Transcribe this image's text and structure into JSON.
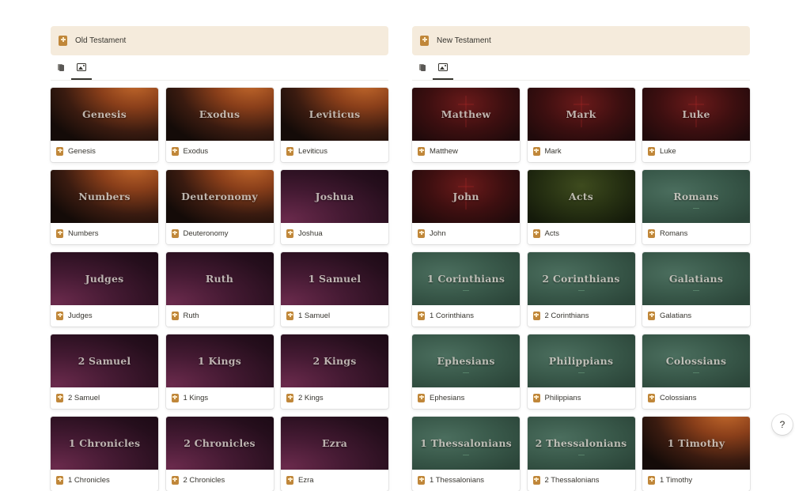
{
  "columns": [
    {
      "title": "Old Testament",
      "books": [
        {
          "name": "Genesis",
          "theme": "brown"
        },
        {
          "name": "Exodus",
          "theme": "brown"
        },
        {
          "name": "Leviticus",
          "theme": "brown"
        },
        {
          "name": "Numbers",
          "theme": "brown"
        },
        {
          "name": "Deuteronomy",
          "theme": "brown"
        },
        {
          "name": "Joshua",
          "theme": "plum"
        },
        {
          "name": "Judges",
          "theme": "plum"
        },
        {
          "name": "Ruth",
          "theme": "plum"
        },
        {
          "name": "1 Samuel",
          "theme": "plum"
        },
        {
          "name": "2 Samuel",
          "theme": "plum"
        },
        {
          "name": "1 Kings",
          "theme": "plum"
        },
        {
          "name": "2 Kings",
          "theme": "plum"
        },
        {
          "name": "1 Chronicles",
          "theme": "plum"
        },
        {
          "name": "2 Chronicles",
          "theme": "plum"
        },
        {
          "name": "Ezra",
          "theme": "plum"
        }
      ]
    },
    {
      "title": "New Testament",
      "books": [
        {
          "name": "Matthew",
          "theme": "red"
        },
        {
          "name": "Mark",
          "theme": "red"
        },
        {
          "name": "Luke",
          "theme": "red"
        },
        {
          "name": "John",
          "theme": "red"
        },
        {
          "name": "Acts",
          "theme": "olive"
        },
        {
          "name": "Romans",
          "theme": "green"
        },
        {
          "name": "1 Corinthians",
          "theme": "green"
        },
        {
          "name": "2 Corinthians",
          "theme": "green"
        },
        {
          "name": "Galatians",
          "theme": "green"
        },
        {
          "name": "Ephesians",
          "theme": "green"
        },
        {
          "name": "Philippians",
          "theme": "green"
        },
        {
          "name": "Colossians",
          "theme": "green"
        },
        {
          "name": "1 Thessalonians",
          "theme": "green"
        },
        {
          "name": "2 Thessalonians",
          "theme": "green"
        },
        {
          "name": "1 Timothy",
          "theme": "brown"
        }
      ]
    }
  ],
  "views": [
    "list-icon",
    "gallery-icon"
  ],
  "active_view": "gallery",
  "help": {
    "label": "?"
  },
  "colors": {
    "header_bg": "#f5ebdc",
    "icon": "#c0873a"
  }
}
